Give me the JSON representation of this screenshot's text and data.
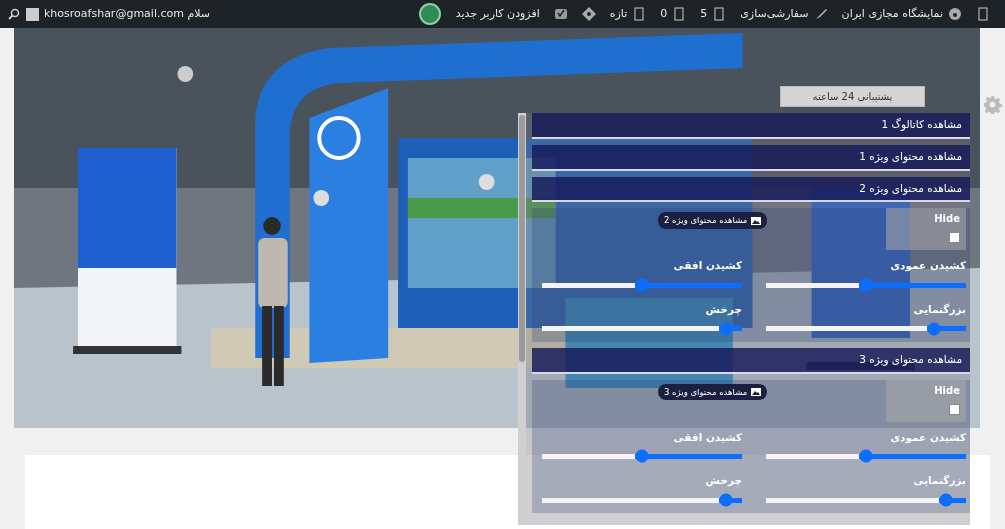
{
  "admin_bar": {
    "items": [
      {
        "kind": "tofu"
      },
      {
        "kind": "site",
        "label": "نمایشگاه مجازی ایران"
      },
      {
        "kind": "customize",
        "label": "سفارشی‌سازی"
      },
      {
        "kind": "comments",
        "label": "5"
      },
      {
        "kind": "updates",
        "label": "0"
      },
      {
        "kind": "new",
        "label": "تازه"
      },
      {
        "kind": "diamond"
      },
      {
        "kind": "shield"
      },
      {
        "kind": "link",
        "label": "افزودن کاربر جدید"
      },
      {
        "kind": "avatar"
      }
    ],
    "greeting": "سلام khosroafshar@gmail.com"
  },
  "support_button": "پشتیبانی 24 ساعته",
  "panel": {
    "sections": [
      {
        "kind": "link",
        "title": "مشاهده کاتالوگ 1"
      },
      {
        "kind": "link",
        "title": "مشاهده محتوای ویژه 1"
      },
      {
        "kind": "content",
        "title": "مشاهده محتوای ویژه 2",
        "tag": "مشاهده محتوای ویژه 2",
        "hide": {
          "label": "Hide",
          "checked": false
        },
        "sliders": [
          {
            "label": "کشیدن عمودی",
            "level": 0.5
          },
          {
            "label": "کشیدن افقی",
            "level": 0.5
          },
          {
            "label": "بزرگنمایی",
            "level": 0.16
          },
          {
            "label": "چرخش",
            "level": 0.08
          }
        ]
      },
      {
        "kind": "content",
        "title": "مشاهده محتوای ویژه 3",
        "tag": "مشاهده محتوای ویژه 3",
        "hide": {
          "label": "Hide",
          "checked": false
        },
        "sliders": [
          {
            "label": "کشیدن عمودی",
            "level": 0.5
          },
          {
            "label": "کشیدن افقی",
            "level": 0.5
          },
          {
            "label": "بزرگنمایی",
            "level": 0.1
          },
          {
            "label": "چرخش",
            "level": 0.08
          }
        ]
      }
    ]
  }
}
